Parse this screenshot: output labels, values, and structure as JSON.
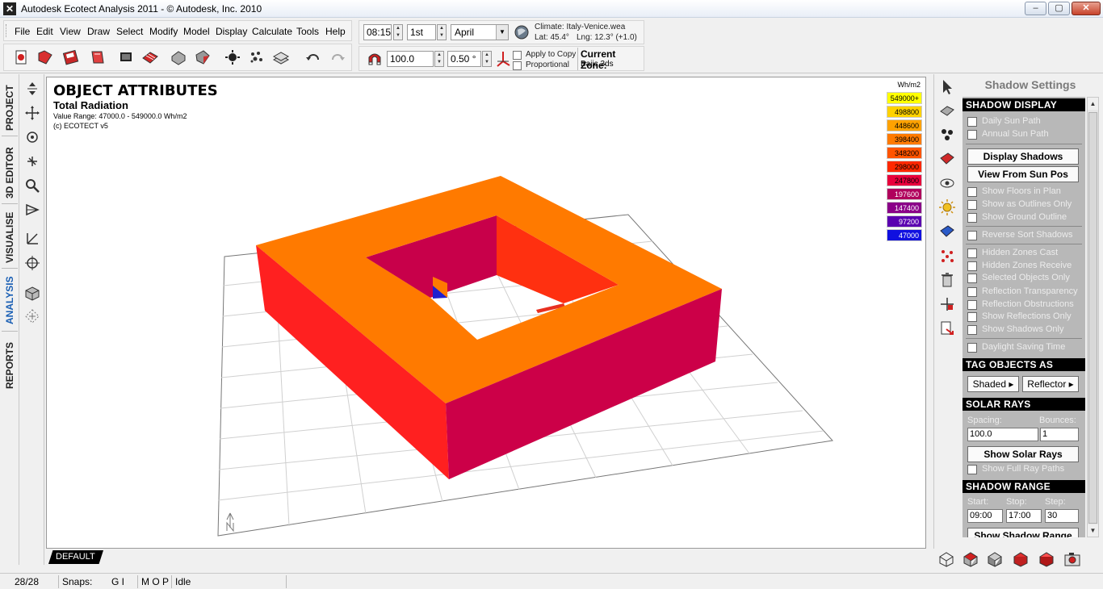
{
  "window": {
    "title": "Autodesk Ecotect Analysis 2011 - © Autodesk, Inc. 2010",
    "buttons": [
      "–",
      "▢",
      "✕"
    ]
  },
  "menu": {
    "items": [
      {
        "label": "File"
      },
      {
        "label": "Edit"
      },
      {
        "label": "View"
      },
      {
        "label": "Draw"
      },
      {
        "label": "Select"
      },
      {
        "label": "Modify"
      },
      {
        "label": "Model"
      },
      {
        "label": "Display"
      },
      {
        "label": "Calculate"
      },
      {
        "label": "Tools"
      },
      {
        "label": "Help"
      }
    ]
  },
  "time_controls": {
    "time": "08:15",
    "day": "1st",
    "month": "April",
    "climate_label": "Climate: Italy-Venice.wea",
    "lat": "Lat: 45.4°",
    "lng": "Lng: 12.3° (+1.0)"
  },
  "shadow_controls": {
    "scale": "100.0",
    "angle": "0.50 °",
    "apply_to_copy": "Apply to Copy",
    "proportional": "Proportional",
    "current_zone_label": "Current Zone:",
    "current_zone_value": "Bajic.3ds"
  },
  "left_tabs": [
    "PROJECT",
    "3D EDITOR",
    "VISUALISE",
    "ANALYSIS",
    "REPORTS"
  ],
  "active_tab": "ANALYSIS",
  "viewport": {
    "title": "OBJECT ATTRIBUTES",
    "subtitle": "Total Radiation",
    "value_range": "Value Range: 47000.0 - 549000.0 Wh/m2",
    "credit": "(c) ECOTECT v5",
    "legend_unit": "Wh/m2",
    "legend": [
      {
        "label": "549000+",
        "color": "#ffff00"
      },
      {
        "label": "498800",
        "color": "#ffd200"
      },
      {
        "label": "448600",
        "color": "#ffa200"
      },
      {
        "label": "398400",
        "color": "#ff7a00"
      },
      {
        "label": "348200",
        "color": "#ff5400"
      },
      {
        "label": "298000",
        "color": "#ff2800"
      },
      {
        "label": "247800",
        "color": "#e8003c"
      },
      {
        "label": "197600",
        "color": "#b0005c"
      },
      {
        "label": "147400",
        "color": "#8a0088"
      },
      {
        "label": "97200",
        "color": "#5a00b0"
      },
      {
        "label": "47000",
        "color": "#1010e0"
      }
    ],
    "layer_tab": "DEFAULT"
  },
  "panel": {
    "title": "Shadow Settings",
    "sections": {
      "shadow_display": {
        "header": "SHADOW DISPLAY",
        "daily_sun_path": "Daily Sun Path",
        "annual_sun_path": "Annual Sun Path",
        "display_shadows": "Display Shadows",
        "view_from_sun": "View From Sun Pos",
        "show_floors": "Show Floors in Plan",
        "show_outlines": "Show as Outlines Only",
        "show_ground": "Show Ground Outline",
        "reverse_sort": "Reverse Sort Shadows",
        "hidden_cast": "Hidden Zones Cast",
        "hidden_receive": "Hidden Zones Receive",
        "selected_only": "Selected Objects Only",
        "refl_transparency": "Reflection Transparency",
        "refl_obstructions": "Reflection Obstructions",
        "show_reflections": "Show Reflections Only",
        "show_shadows": "Show Shadows Only",
        "daylight_saving": "Daylight Saving Time"
      },
      "tag_objects": {
        "header": "TAG OBJECTS AS",
        "shaded": "Shaded",
        "reflector": "Reflector"
      },
      "solar_rays": {
        "header": "SOLAR RAYS",
        "spacing_label": "Spacing:",
        "bounces_label": "Bounces:",
        "spacing": "100.0",
        "bounces": "1",
        "show_rays": "Show Solar Rays",
        "full_paths": "Show Full Ray Paths"
      },
      "shadow_range": {
        "header": "SHADOW RANGE",
        "start_label": "Start:",
        "stop_label": "Stop:",
        "step_label": "Step:",
        "start": "09:00",
        "stop": "17:00",
        "step": "30",
        "show_range": "Show Shadow Range"
      }
    }
  },
  "status": {
    "count": "28/28",
    "snaps_label": "Snaps:",
    "snaps_value": "G I",
    "mode": "M O P",
    "state": "Idle"
  }
}
